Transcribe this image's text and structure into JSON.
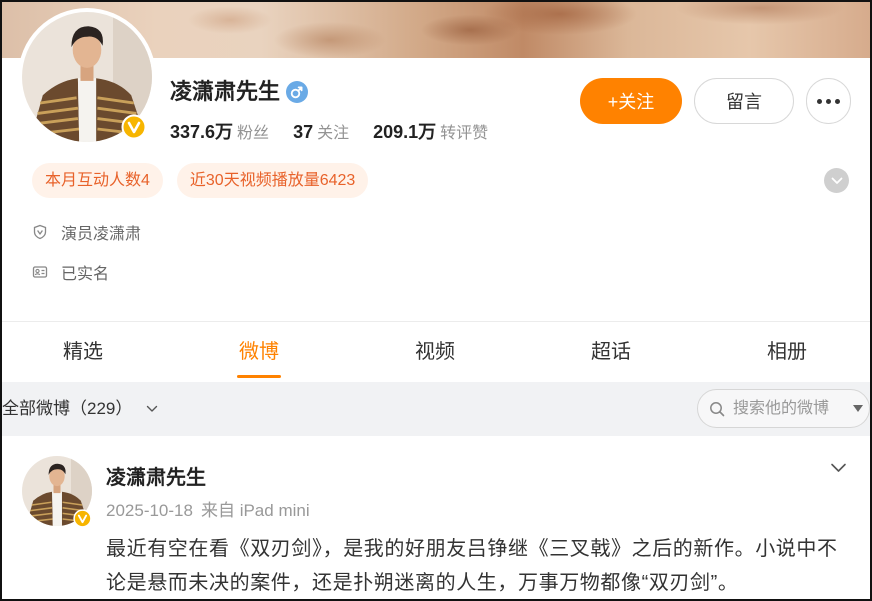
{
  "colors": {
    "accent": "#ff8200",
    "tag_background": "#fff2e9",
    "tag_text": "#e8622a",
    "verified_badge": "#f7b500",
    "gender_male": "#6aaae6",
    "feed_bar_background": "#f1f2f4"
  },
  "profile": {
    "avatar_icon": "user-avatar",
    "verified_icon": "verified-badge-icon",
    "name": "凌潇肃先生",
    "gender_icon": "male-icon",
    "stats": [
      {
        "value": "337.6万",
        "label": "粉丝"
      },
      {
        "value": "37",
        "label": "关注"
      },
      {
        "value": "209.1万",
        "label": "转评赞"
      }
    ],
    "actions": {
      "follow_label": "+关注",
      "message_label": "留言",
      "more_icon": "more-dots-icon"
    },
    "tags": [
      {
        "label": "本月互动人数4"
      },
      {
        "label": "近30天视频播放量6423"
      }
    ],
    "expand_icon": "chevron-down-icon",
    "info": [
      {
        "icon": "shield-verified-icon",
        "text": "演员凌潇肃"
      },
      {
        "icon": "id-card-icon",
        "text": "已实名"
      }
    ]
  },
  "tabs": [
    {
      "label": "精选"
    },
    {
      "label": "微博",
      "active": true
    },
    {
      "label": "视频"
    },
    {
      "label": "超话"
    },
    {
      "label": "相册"
    }
  ],
  "feed_bar": {
    "filter_label": "全部微博（229）",
    "filter_icon": "chevron-down-icon",
    "search_icon": "search-icon",
    "search_placeholder": "搜索他的微博"
  },
  "posts": [
    {
      "author": "凌潇肃先生",
      "time": "2025-10-18",
      "source": "来自 iPad mini",
      "menu_icon": "chevron-down-icon",
      "text": "最近有空在看《双刃剑》，是我的好朋友吕铮继《三叉戟》之后的新作。小说中不论是悬而未决的案件，还是扑朔迷离的人生，万事万物都像“双刃剑”。"
    }
  ]
}
